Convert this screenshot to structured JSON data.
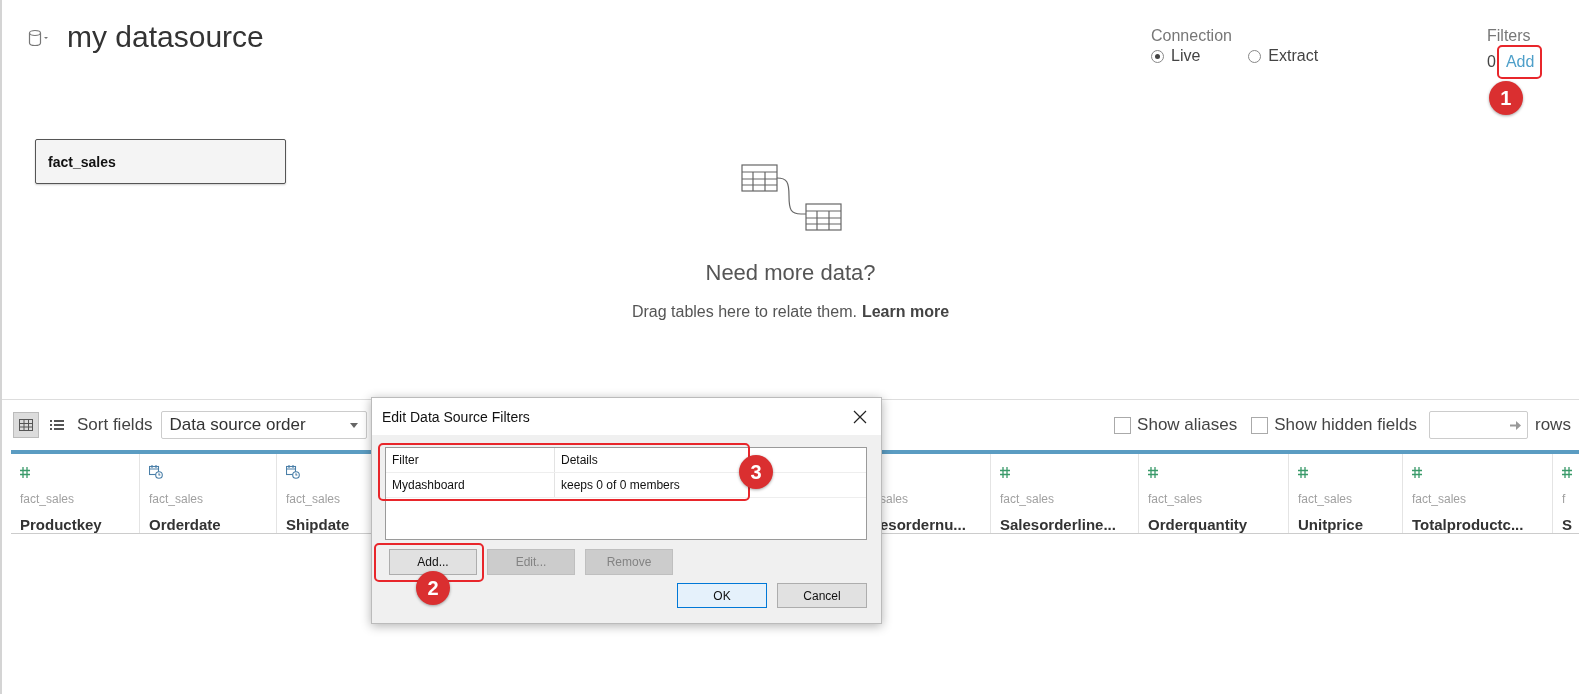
{
  "header": {
    "title": "my datasource",
    "connection": {
      "label": "Connection",
      "options": [
        {
          "label": "Live",
          "selected": true
        },
        {
          "label": "Extract",
          "selected": false
        }
      ]
    },
    "filters": {
      "label": "Filters",
      "count": "0",
      "add_link": "Add",
      "callout": "1"
    }
  },
  "canvas": {
    "tables": [
      "fact_sales"
    ],
    "empty_state": {
      "heading": "Need more data?",
      "text": "Drag tables here to relate them.",
      "link": "Learn more"
    }
  },
  "toolbar": {
    "views": [
      {
        "kind": "grid",
        "selected": true
      },
      {
        "kind": "list",
        "selected": false
      }
    ],
    "sort_label": "Sort fields",
    "sort_value": "Data source order",
    "checkboxes": [
      {
        "label": "Show aliases",
        "checked": false
      },
      {
        "label": "Show hidden fields",
        "checked": false
      }
    ],
    "rows_label": "rows"
  },
  "columns": [
    {
      "kind": "number",
      "table": "fact_sales",
      "name": "Productkey"
    },
    {
      "kind": "date",
      "table": "fact_sales",
      "name": "Orderdate"
    },
    {
      "kind": "date",
      "table": "fact_sales",
      "name": "Shipdate"
    },
    {
      "table": "sales",
      "name": "esordernu..."
    },
    {
      "kind": "number",
      "table": "fact_sales",
      "name": "Salesorderline..."
    },
    {
      "kind": "number",
      "table": "fact_sales",
      "name": "Orderquantity"
    },
    {
      "kind": "number",
      "table": "fact_sales",
      "name": "Unitprice"
    },
    {
      "kind": "number",
      "table": "fact_sales",
      "name": "Totalproductc..."
    },
    {
      "kind": "number",
      "table": "f",
      "name": "S"
    }
  ],
  "dialog": {
    "title": "Edit Data Source Filters",
    "list": {
      "columns": [
        "Filter",
        "Details"
      ],
      "rows": [
        {
          "cells": [
            "Mydashboard",
            "keeps 0 of 0 members"
          ]
        }
      ],
      "callout": "3"
    },
    "buttons": [
      {
        "label": "Add...",
        "disabled": false,
        "callout": "2"
      },
      {
        "label": "Edit...",
        "disabled": true
      },
      {
        "label": "Remove",
        "disabled": true
      }
    ],
    "actions": [
      {
        "label": "OK",
        "default": true
      },
      {
        "label": "Cancel",
        "default": false
      }
    ]
  }
}
